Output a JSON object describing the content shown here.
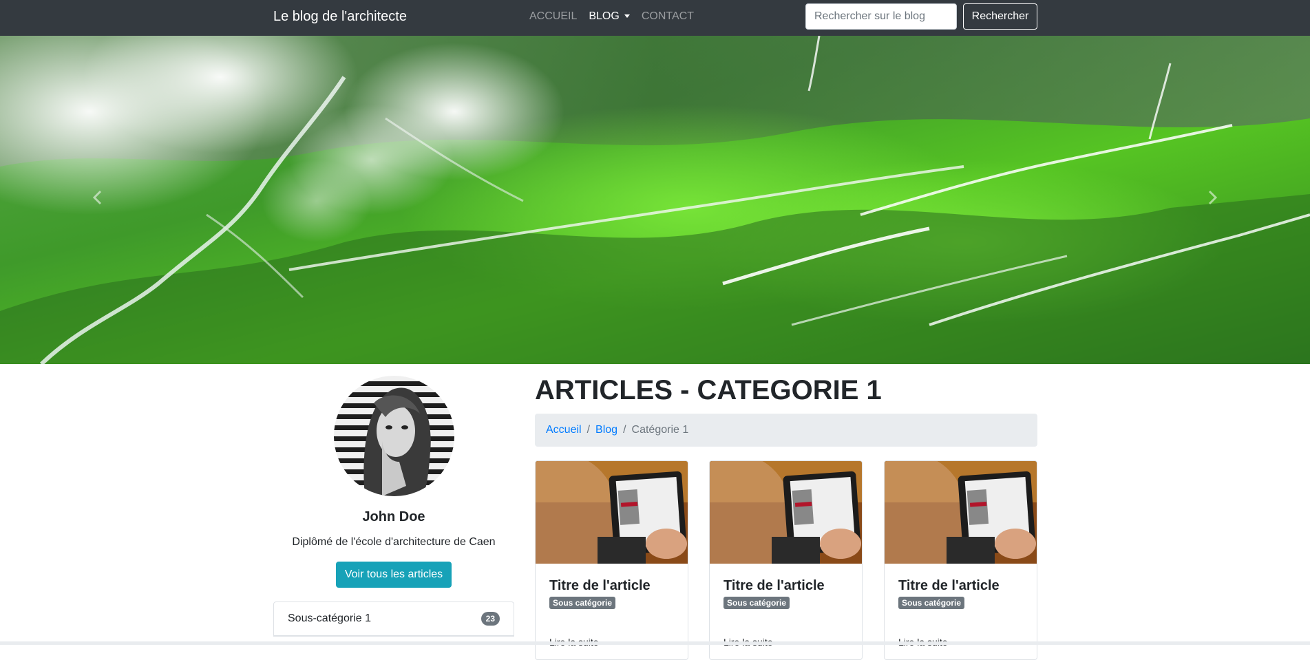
{
  "navbar": {
    "brand": "Le blog de l'architecte",
    "items": [
      {
        "label": "ACCUEIL",
        "active": false
      },
      {
        "label": "BLOG",
        "active": true,
        "dropdown": true
      },
      {
        "label": "CONTACT",
        "active": false
      }
    ],
    "search": {
      "placeholder": "Rechercher sur le blog",
      "button_label": "Rechercher"
    },
    "background_color": "#343a40"
  },
  "hero": {
    "prev_icon": "chevron-left-icon",
    "next_icon": "chevron-right-icon"
  },
  "profile": {
    "name": "John Doe",
    "description": "Diplômé de l'école d'architecture de Caen",
    "button_label": "Voir tous les articles",
    "button_color": "#17a2b8"
  },
  "subcategories": [
    {
      "label": "Sous-catégorie 1",
      "count": "23"
    }
  ],
  "main": {
    "title": "ARTICLES - CATEGORIE 1",
    "breadcrumb": [
      "Accueil",
      "Blog",
      "Catégorie 1"
    ],
    "breadcrumb_separator": "/",
    "cards": [
      {
        "title": "Titre de l'article",
        "badge": "Sous catégorie",
        "more": "Lire la suite"
      },
      {
        "title": "Titre de l'article",
        "badge": "Sous catégorie",
        "more": "Lire la suite"
      },
      {
        "title": "Titre de l'article",
        "badge": "Sous catégorie",
        "more": "Lire la suite"
      }
    ]
  },
  "colors": {
    "link": "#007bff",
    "badge": "#6c757d"
  }
}
